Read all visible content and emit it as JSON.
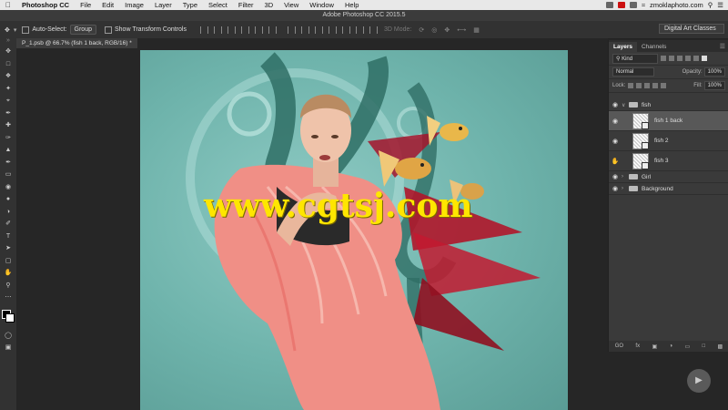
{
  "menubar": {
    "app": "Photoshop CC",
    "items": [
      "File",
      "Edit",
      "Image",
      "Layer",
      "Type",
      "Select",
      "Filter",
      "3D",
      "View",
      "Window",
      "Help"
    ],
    "site": "zmoklaphoto.com"
  },
  "window": {
    "title": "Adobe Photoshop CC 2015.5"
  },
  "options": {
    "auto_select": "Auto-Select:",
    "group": "Group",
    "transform": "Show Transform Controls",
    "mode3d": "3D Mode:",
    "workspace": "Digital Art Classes"
  },
  "document": {
    "tab": "P_1.psb @ 66.7% (fish 1 back, RGB/16) *"
  },
  "watermark": "www.cgtsj.com",
  "layers": {
    "tab_layers": "Layers",
    "tab_channels": "Channels",
    "filter": "Kind",
    "blend": "Normal",
    "opacity_label": "Opacity:",
    "opacity": "100%",
    "lock_label": "Lock:",
    "fill_label": "Fill:",
    "fill": "100%",
    "items": [
      {
        "name": "fish",
        "type": "group"
      },
      {
        "name": "fish 1 back",
        "type": "layer"
      },
      {
        "name": "fish 2",
        "type": "layer"
      },
      {
        "name": "fish 3",
        "type": "layer"
      },
      {
        "name": "Girl",
        "type": "group"
      },
      {
        "name": "Background",
        "type": "group"
      }
    ],
    "footer": [
      "GO",
      "fx"
    ]
  }
}
